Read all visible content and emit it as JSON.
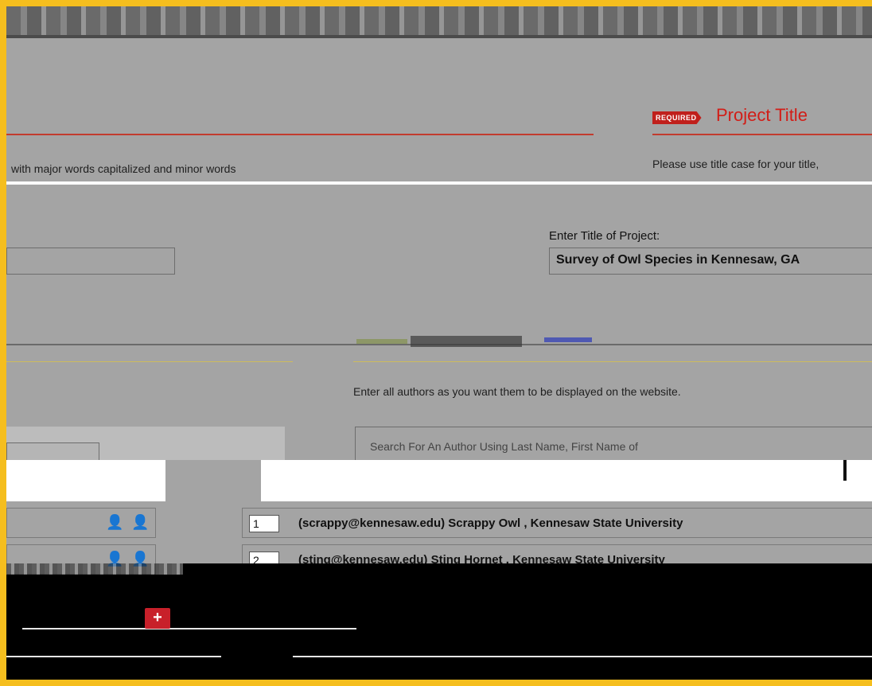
{
  "header": {
    "required_badge": "REQUIRED",
    "title": "Project Title"
  },
  "hints": {
    "left_fragment": "with major words capitalized and minor words",
    "right_fragment": "Please use title case for your title,"
  },
  "project_title_field": {
    "label": "Enter Title of Project:",
    "value": "Survey of Owl Species in Kennesaw, GA"
  },
  "authors": {
    "hint": "Enter all authors as you want them to be displayed on the website.",
    "search_placeholder": "Search For An Author Using Last Name, First Name of",
    "rows": [
      {
        "order": "1",
        "text": "(scrappy@kennesaw.edu) Scrappy Owl , Kennesaw State University"
      },
      {
        "order": "2",
        "text": "(sting@kennesaw.edu) Sting Hornet , Kennesaw State University"
      }
    ],
    "add_button_label": "+"
  },
  "icons": {
    "remove_author": "remove-user-icon",
    "edit_author": "edit-user-icon",
    "add": "plus-icon"
  }
}
